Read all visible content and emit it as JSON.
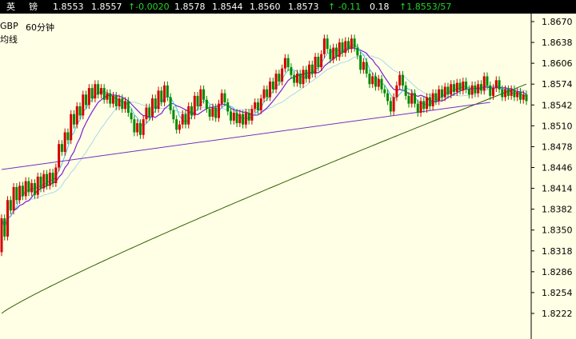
{
  "quote": {
    "symbol_char1": "英",
    "symbol_char2": "镑",
    "last": "1.8553",
    "ask": "1.8557",
    "change": "↑-0.0020",
    "open": "1.8578",
    "low": "1.8544",
    "prev_close": "1.8560",
    "high": "1.8573",
    "change_pct": "↑ -0.11",
    "amplitude": "0.18",
    "bid_ask": "↑1.8553/57"
  },
  "colors": {
    "background": "#ffffe5",
    "quote_bar": "#000000",
    "up_candle": "#d40000",
    "down_candle": "#008a00",
    "ma_fast": "#3ac6f0",
    "ma_mid": "#7a20d8",
    "ma_slow_light": "#a8d8ee",
    "ma_long": "#2f6000",
    "trendline": "#7030c0"
  },
  "chart_labels": {
    "symbol": "GBP",
    "period": "60分钟",
    "indicator": "均线"
  },
  "chart_data": {
    "type": "candlestick",
    "ylim": [
      1.82,
      1.865
    ],
    "yticks": [
      "1.8670",
      "1.8638",
      "1.8606",
      "1.8574",
      "1.8542",
      "1.8510",
      "1.8478",
      "1.8446",
      "1.8414",
      "1.8382",
      "1.8350",
      "1.8318",
      "1.8286",
      "1.8254",
      "1.8222"
    ],
    "candles": [
      [
        1.8316,
        1.8368
      ],
      [
        1.8368,
        1.834
      ],
      [
        1.834,
        1.8396
      ],
      [
        1.8396,
        1.838
      ],
      [
        1.838,
        1.8416
      ],
      [
        1.8416,
        1.8396
      ],
      [
        1.8396,
        1.8418
      ],
      [
        1.8418,
        1.8402
      ],
      [
        1.8402,
        1.8425
      ],
      [
        1.8425,
        1.8408
      ],
      [
        1.8408,
        1.8422
      ],
      [
        1.8422,
        1.8404
      ],
      [
        1.8404,
        1.8432
      ],
      [
        1.8432,
        1.8414
      ],
      [
        1.8414,
        1.8436
      ],
      [
        1.8436,
        1.8418
      ],
      [
        1.8418,
        1.8438
      ],
      [
        1.8438,
        1.8422
      ],
      [
        1.8422,
        1.8446
      ],
      [
        1.8446,
        1.8482
      ],
      [
        1.8482,
        1.847
      ],
      [
        1.847,
        1.85
      ],
      [
        1.85,
        1.8488
      ],
      [
        1.8488,
        1.8528
      ],
      [
        1.8528,
        1.8512
      ],
      [
        1.8512,
        1.854
      ],
      [
        1.854,
        1.8526
      ],
      [
        1.8526,
        1.8558
      ],
      [
        1.8558,
        1.8542
      ],
      [
        1.8542,
        1.8568
      ],
      [
        1.8568,
        1.8552
      ],
      [
        1.8552,
        1.8574
      ],
      [
        1.8574,
        1.8558
      ],
      [
        1.8558,
        1.8568
      ],
      [
        1.8568,
        1.855
      ],
      [
        1.855,
        1.856
      ],
      [
        1.856,
        1.8544
      ],
      [
        1.8544,
        1.8556
      ],
      [
        1.8556,
        1.854
      ],
      [
        1.854,
        1.8552
      ],
      [
        1.8552,
        1.8536
      ],
      [
        1.8536,
        1.8548
      ],
      [
        1.8548,
        1.853
      ],
      [
        1.853,
        1.852
      ],
      [
        1.852,
        1.85
      ],
      [
        1.85,
        1.8514
      ],
      [
        1.8514,
        1.8496
      ],
      [
        1.8496,
        1.852
      ],
      [
        1.852,
        1.8538
      ],
      [
        1.8538,
        1.8524
      ],
      [
        1.8524,
        1.8552
      ],
      [
        1.8552,
        1.8536
      ],
      [
        1.8536,
        1.8564
      ],
      [
        1.8564,
        1.8546
      ],
      [
        1.8546,
        1.8572
      ],
      [
        1.8572,
        1.8554
      ],
      [
        1.8554,
        1.8534
      ],
      [
        1.8534,
        1.852
      ],
      [
        1.852,
        1.8504
      ],
      [
        1.8504,
        1.8512
      ],
      [
        1.8512,
        1.8528
      ],
      [
        1.8528,
        1.8512
      ],
      [
        1.8512,
        1.854
      ],
      [
        1.854,
        1.8526
      ],
      [
        1.8526,
        1.8556
      ],
      [
        1.8556,
        1.854
      ],
      [
        1.854,
        1.8566
      ],
      [
        1.8566,
        1.855
      ],
      [
        1.855,
        1.8536
      ],
      [
        1.8536,
        1.8524
      ],
      [
        1.8524,
        1.8538
      ],
      [
        1.8538,
        1.8522
      ],
      [
        1.8522,
        1.8544
      ],
      [
        1.8544,
        1.856
      ],
      [
        1.856,
        1.8546
      ],
      [
        1.8546,
        1.8532
      ],
      [
        1.8532,
        1.8518
      ],
      [
        1.8518,
        1.853
      ],
      [
        1.853,
        1.8514
      ],
      [
        1.8514,
        1.8528
      ],
      [
        1.8528,
        1.8512
      ],
      [
        1.8512,
        1.853
      ],
      [
        1.853,
        1.8518
      ],
      [
        1.8518,
        1.8536
      ],
      [
        1.8536,
        1.8546
      ],
      [
        1.8546,
        1.8534
      ],
      [
        1.8534,
        1.8552
      ],
      [
        1.8552,
        1.8566
      ],
      [
        1.8566,
        1.8554
      ],
      [
        1.8554,
        1.8578
      ],
      [
        1.8578,
        1.8566
      ],
      [
        1.8566,
        1.859
      ],
      [
        1.859,
        1.8578
      ],
      [
        1.8578,
        1.8598
      ],
      [
        1.8598,
        1.8614
      ],
      [
        1.8614,
        1.86
      ],
      [
        1.86,
        1.8588
      ],
      [
        1.8588,
        1.8576
      ],
      [
        1.8576,
        1.859
      ],
      [
        1.859,
        1.8574
      ],
      [
        1.8574,
        1.8596
      ],
      [
        1.8596,
        1.8582
      ],
      [
        1.8582,
        1.8604
      ],
      [
        1.8604,
        1.859
      ],
      [
        1.859,
        1.8616
      ],
      [
        1.8616,
        1.86
      ],
      [
        1.86,
        1.862
      ],
      [
        1.862,
        1.8644
      ],
      [
        1.8644,
        1.8628
      ],
      [
        1.8628,
        1.8612
      ],
      [
        1.8612,
        1.863
      ],
      [
        1.863,
        1.8616
      ],
      [
        1.8616,
        1.8638
      ],
      [
        1.8638,
        1.8622
      ],
      [
        1.8622,
        1.864
      ],
      [
        1.864,
        1.8628
      ],
      [
        1.8628,
        1.8644
      ],
      [
        1.8644,
        1.863
      ],
      [
        1.863,
        1.8618
      ],
      [
        1.8618,
        1.8596
      ],
      [
        1.8596,
        1.8608
      ],
      [
        1.8608,
        1.859
      ],
      [
        1.859,
        1.8574
      ],
      [
        1.8574,
        1.8586
      ],
      [
        1.8586,
        1.857
      ],
      [
        1.857,
        1.8582
      ],
      [
        1.8582,
        1.8566
      ],
      [
        1.8566,
        1.856
      ],
      [
        1.856,
        1.8548
      ],
      [
        1.8548,
        1.8532
      ],
      [
        1.8532,
        1.8554
      ],
      [
        1.8554,
        1.8572
      ],
      [
        1.8572,
        1.8588
      ],
      [
        1.8588,
        1.8572
      ],
      [
        1.8572,
        1.8556
      ],
      [
        1.8556,
        1.8544
      ],
      [
        1.8544,
        1.856
      ],
      [
        1.856,
        1.8544
      ],
      [
        1.8544,
        1.853
      ],
      [
        1.853,
        1.8548
      ],
      [
        1.8548,
        1.8536
      ],
      [
        1.8536,
        1.8554
      ],
      [
        1.8554,
        1.854
      ],
      [
        1.854,
        1.856
      ],
      [
        1.856,
        1.8548
      ],
      [
        1.8548,
        1.8566
      ],
      [
        1.8566,
        1.8554
      ],
      [
        1.8554,
        1.857
      ],
      [
        1.857,
        1.8558
      ],
      [
        1.8558,
        1.8574
      ],
      [
        1.8574,
        1.8562
      ],
      [
        1.8562,
        1.8576
      ],
      [
        1.8576,
        1.8564
      ],
      [
        1.8564,
        1.8578
      ],
      [
        1.8578,
        1.8566
      ],
      [
        1.8566,
        1.8558
      ],
      [
        1.8558,
        1.8572
      ],
      [
        1.8572,
        1.856
      ],
      [
        1.856,
        1.8574
      ],
      [
        1.8574,
        1.8564
      ],
      [
        1.8564,
        1.8586
      ],
      [
        1.8586,
        1.8572
      ],
      [
        1.8572,
        1.8556
      ],
      [
        1.8556,
        1.8568
      ],
      [
        1.8568,
        1.858
      ],
      [
        1.858,
        1.8566
      ],
      [
        1.8566,
        1.8554
      ],
      [
        1.8554,
        1.8566
      ],
      [
        1.8566,
        1.8556
      ],
      [
        1.8556,
        1.8566
      ],
      [
        1.8566,
        1.8554
      ],
      [
        1.8554,
        1.8562
      ],
      [
        1.8562,
        1.855
      ],
      [
        1.855,
        1.8558
      ],
      [
        1.8558,
        1.8548
      ]
    ],
    "trendline_points": [
      [
        0,
        1.8443
      ],
      [
        162,
        1.8546
      ]
    ],
    "title": "",
    "grid": false
  }
}
